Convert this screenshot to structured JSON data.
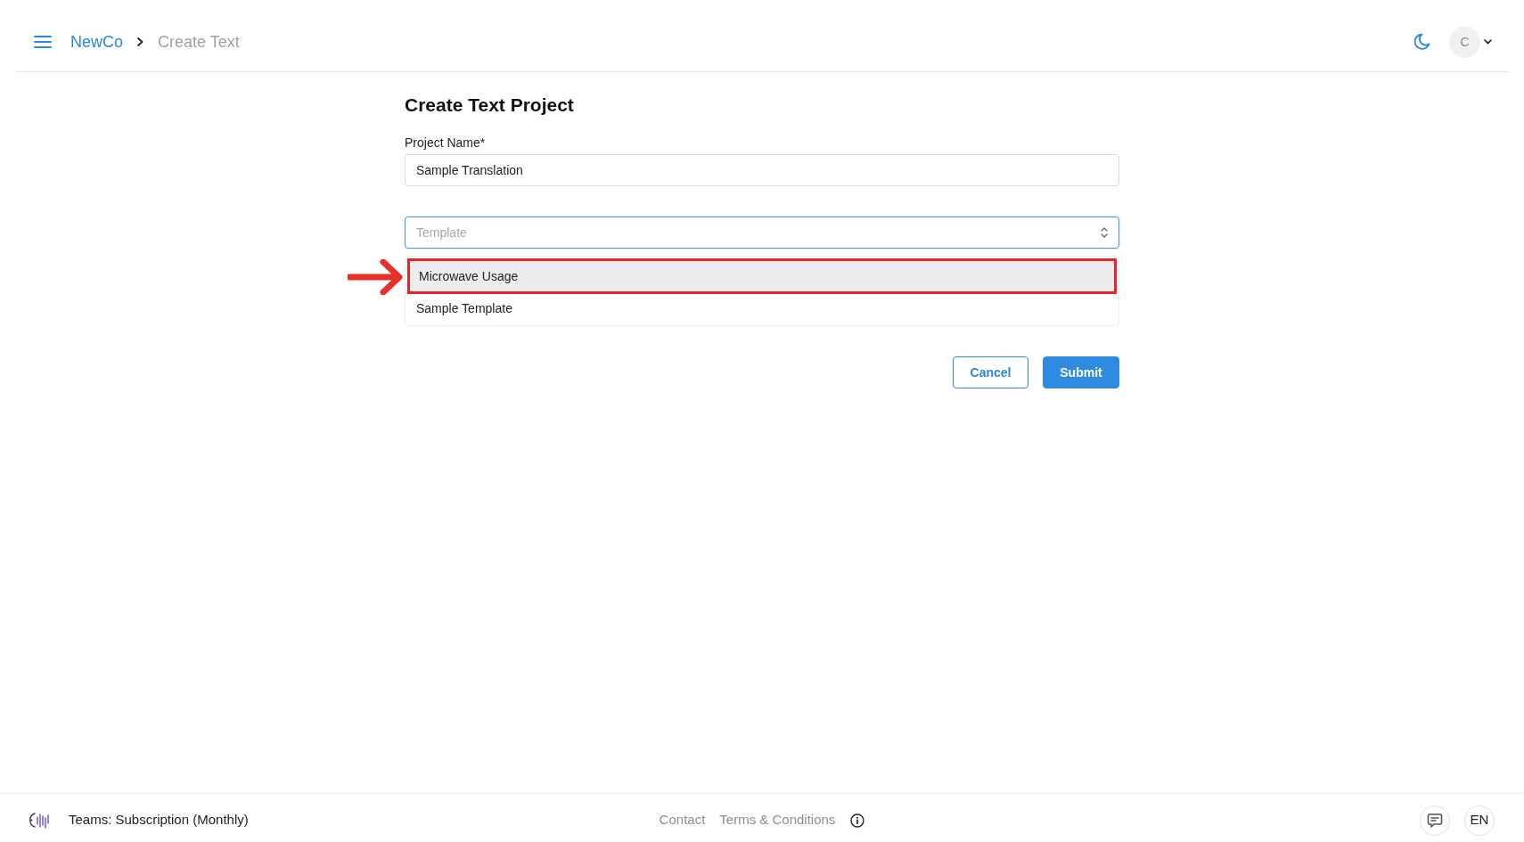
{
  "header": {
    "breadcrumb": [
      {
        "label": "NewCo",
        "kind": "link"
      },
      {
        "label": "Create Text",
        "kind": "current"
      }
    ],
    "avatar": {
      "initial": "C"
    }
  },
  "form": {
    "title": "Create Text Project",
    "fields": [
      {
        "kind": "text",
        "label": "Project Name*",
        "value": "Sample Translation"
      },
      {
        "kind": "select",
        "placeholder": "Template",
        "focused": true,
        "options": [
          {
            "label": "Microwave Usage",
            "selected": true,
            "annotated": true
          },
          {
            "label": "Sample Template",
            "selected": false,
            "annotated": false
          }
        ]
      }
    ],
    "buttons": [
      {
        "label": "Cancel",
        "kind": "secondary"
      },
      {
        "label": "Submit",
        "kind": "primary"
      }
    ]
  },
  "footer": {
    "plan": "Teams: Subscription (Monthly)",
    "links": [
      "Contact",
      "Terms & Conditions"
    ],
    "language": "EN"
  }
}
